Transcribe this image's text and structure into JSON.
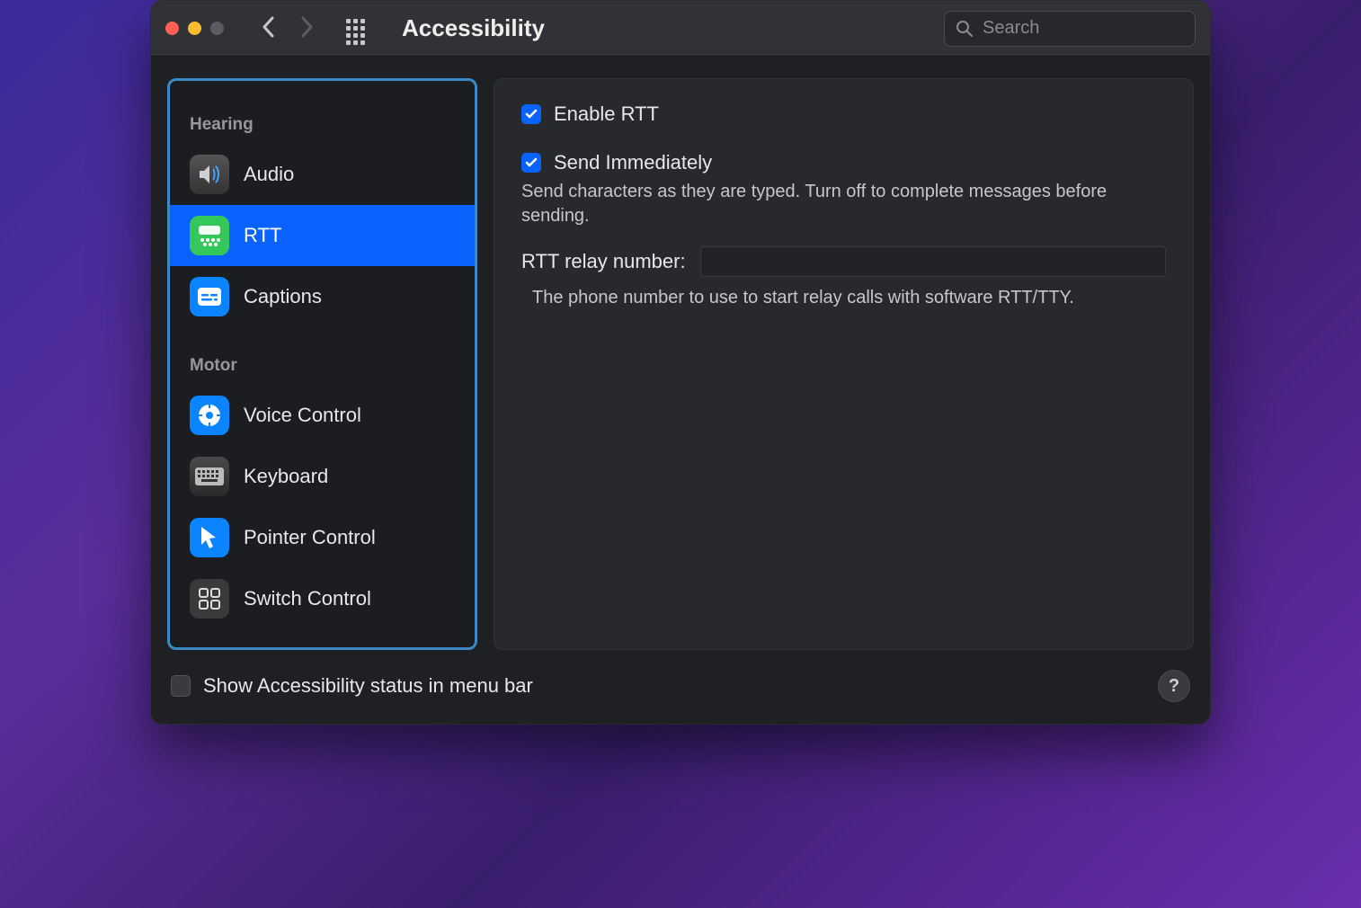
{
  "window": {
    "title": "Accessibility"
  },
  "search": {
    "placeholder": "Search",
    "value": ""
  },
  "sidebar": {
    "sections": [
      {
        "header": "Hearing"
      },
      {
        "header": "Motor"
      }
    ],
    "items_hearing": [
      {
        "label": "Audio"
      },
      {
        "label": "RTT"
      },
      {
        "label": "Captions"
      }
    ],
    "items_motor": [
      {
        "label": "Voice Control"
      },
      {
        "label": "Keyboard"
      },
      {
        "label": "Pointer Control"
      },
      {
        "label": "Switch Control"
      }
    ],
    "selected": "RTT"
  },
  "pane": {
    "enable_rtt": {
      "label": "Enable RTT",
      "checked": true
    },
    "send_immediately": {
      "label": "Send Immediately",
      "checked": true,
      "description": "Send characters as they are typed. Turn off to complete messages before sending."
    },
    "relay": {
      "label": "RTT relay number:",
      "value": "",
      "description": "The phone number to use to start relay calls with software RTT/TTY."
    }
  },
  "footer": {
    "show_status": {
      "label": "Show Accessibility status in menu bar",
      "checked": false
    }
  }
}
